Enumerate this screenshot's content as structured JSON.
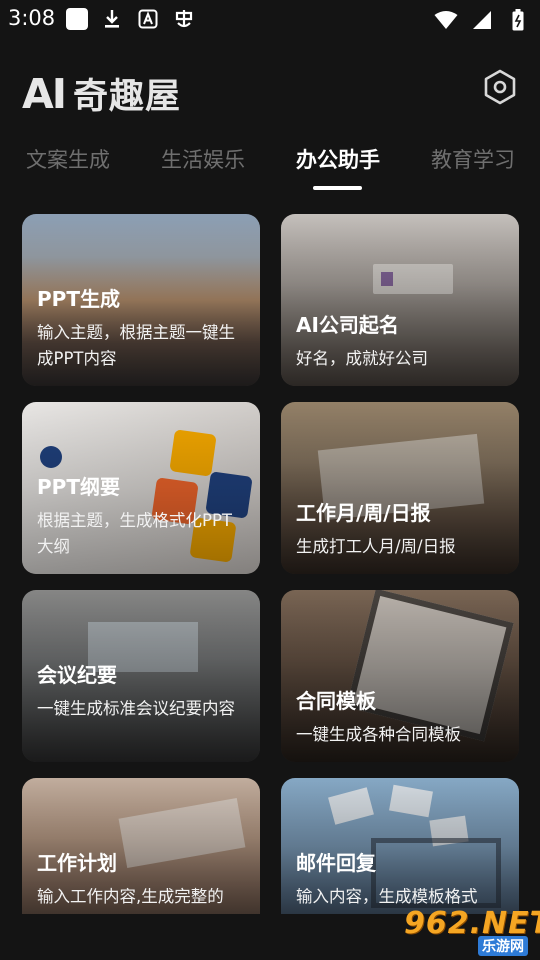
{
  "status_bar": {
    "time": "3:08"
  },
  "header": {
    "logo_ai": "AI",
    "logo_cn": "奇趣屋"
  },
  "tabs": [
    {
      "label": "文案生成",
      "active": false
    },
    {
      "label": "生活娱乐",
      "active": false
    },
    {
      "label": "办公助手",
      "active": true
    },
    {
      "label": "教育学习",
      "active": false
    }
  ],
  "cards": [
    {
      "title": "PPT生成",
      "desc": "输入主题，根据主题一键生成PPT内容"
    },
    {
      "title": "AI公司起名",
      "desc": "好名，成就好公司"
    },
    {
      "title": "PPT纲要",
      "desc": "根据主题，生成格式化PPT大纲"
    },
    {
      "title": "工作月/周/日报",
      "desc": "生成打工人月/周/日报"
    },
    {
      "title": "会议纪要",
      "desc": "一键生成标准会议纪要内容"
    },
    {
      "title": "合同模板",
      "desc": "一键生成各种合同模板"
    },
    {
      "title": "工作计划",
      "desc": "输入工作内容,生成完整的"
    },
    {
      "title": "邮件回复",
      "desc": "输入内容，生成模板格式"
    }
  ],
  "watermark": {
    "big": "962.NET",
    "small": "乐游网"
  },
  "colors": {
    "background": "#141414",
    "active_tab": "#ffffff",
    "inactive_tab": "#6f6f6f",
    "watermark": "#f5a623"
  }
}
